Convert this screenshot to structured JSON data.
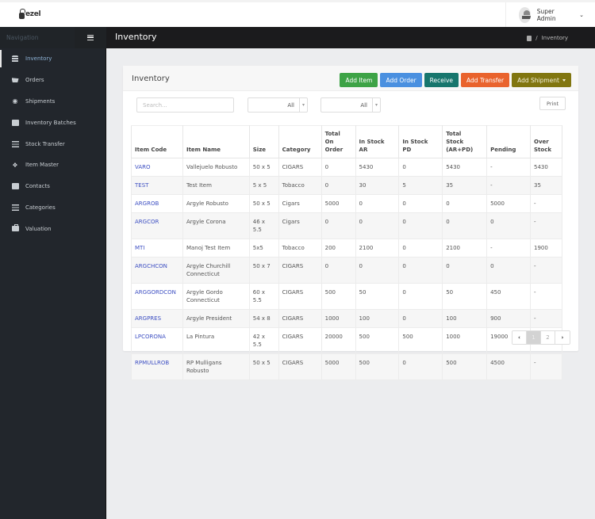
{
  "app": {
    "logo_text": "ezel",
    "user_name": "Super Admin"
  },
  "navbar": {
    "nav_label": "Navigation",
    "page_title": "Inventory",
    "breadcrumb": {
      "separator": "/",
      "current": "Inventory"
    }
  },
  "sidebar": {
    "items": [
      {
        "label": "Inventory",
        "icon": "database-icon",
        "active": true
      },
      {
        "label": "Orders",
        "icon": "cart-icon"
      },
      {
        "label": "Shipments",
        "icon": "motorcycle-icon"
      },
      {
        "label": "Inventory Batches",
        "icon": "users-icon"
      },
      {
        "label": "Stock Transfer",
        "icon": "sliders-icon"
      },
      {
        "label": "Item Master",
        "icon": "cubes-icon"
      },
      {
        "label": "Contacts",
        "icon": "users-icon"
      },
      {
        "label": "Categories",
        "icon": "list-icon"
      },
      {
        "label": "Valuation",
        "icon": "briefcase-icon"
      }
    ]
  },
  "panel": {
    "title": "Inventory",
    "buttons": {
      "add_item": "Add Item",
      "add_order": "Add Order",
      "receive": "Receive",
      "add_transfer": "Add Transfer",
      "add_shipment": "Add Shipment"
    },
    "button_colors": {
      "add_item": "#3da346",
      "add_order": "#4a90e0",
      "receive": "#17766d",
      "add_transfer": "#e9632d",
      "add_shipment": "#817610"
    },
    "search_placeholder": "Search...",
    "filter1_value": "All",
    "filter2_value": "All",
    "print_label": "Print"
  },
  "table": {
    "headers": [
      [
        "Item Code"
      ],
      [
        "Item Name"
      ],
      [
        "Size"
      ],
      [
        "Category"
      ],
      [
        "Total",
        "On",
        "Order"
      ],
      [
        "In Stock",
        "AR"
      ],
      [
        "In Stock",
        "PD"
      ],
      [
        "Total",
        "Stock",
        "(AR+PD)"
      ],
      [
        "Pending"
      ],
      [
        "Over",
        "Stock"
      ]
    ],
    "rows": [
      [
        "VARO",
        "Vallejuelo Robusto",
        "50 x 5",
        "CIGARS",
        "0",
        "5430",
        "0",
        "5430",
        "-",
        "5430"
      ],
      [
        "TEST",
        "Test Item",
        "5 x 5",
        "Tobacco",
        "0",
        "30",
        "5",
        "35",
        "-",
        "35"
      ],
      [
        "ARGROB",
        "Argyle Robusto",
        "50 x 5",
        "Cigars",
        "5000",
        "0",
        "0",
        "0",
        "5000",
        "-"
      ],
      [
        "ARGCOR",
        "Argyle Corona",
        "46 x 5.5",
        "Cigars",
        "0",
        "0",
        "0",
        "0",
        "0",
        "-"
      ],
      [
        "MTI",
        "Manoj Test Item",
        "5x5",
        "Tobacco",
        "200",
        "2100",
        "0",
        "2100",
        "-",
        "1900"
      ],
      [
        "ARGCHCON",
        "Argyle Churchill Connecticut",
        "50 x 7",
        "CIGARS",
        "0",
        "0",
        "0",
        "0",
        "0",
        "-"
      ],
      [
        "ARGGORDCON",
        "Argyle Gordo Connecticut",
        "60 x 5.5",
        "CIGARS",
        "500",
        "50",
        "0",
        "50",
        "450",
        "-"
      ],
      [
        "ARGPRES",
        "Argyle President",
        "54 x 8",
        "CIGARS",
        "1000",
        "100",
        "0",
        "100",
        "900",
        "-"
      ],
      [
        "LPCORONA",
        "La Pintura",
        "42 x 5.5",
        "CIGARS",
        "20000",
        "500",
        "500",
        "1000",
        "19000",
        "-"
      ],
      [
        "RPMULLROB",
        "RP Mulligans Robusto",
        "50 x 5",
        "CIGARS",
        "5000",
        "500",
        "0",
        "500",
        "4500",
        "-"
      ]
    ]
  },
  "pagination": {
    "prev": "‹",
    "pages": [
      "1",
      "2"
    ],
    "current": "1",
    "next": "›"
  }
}
